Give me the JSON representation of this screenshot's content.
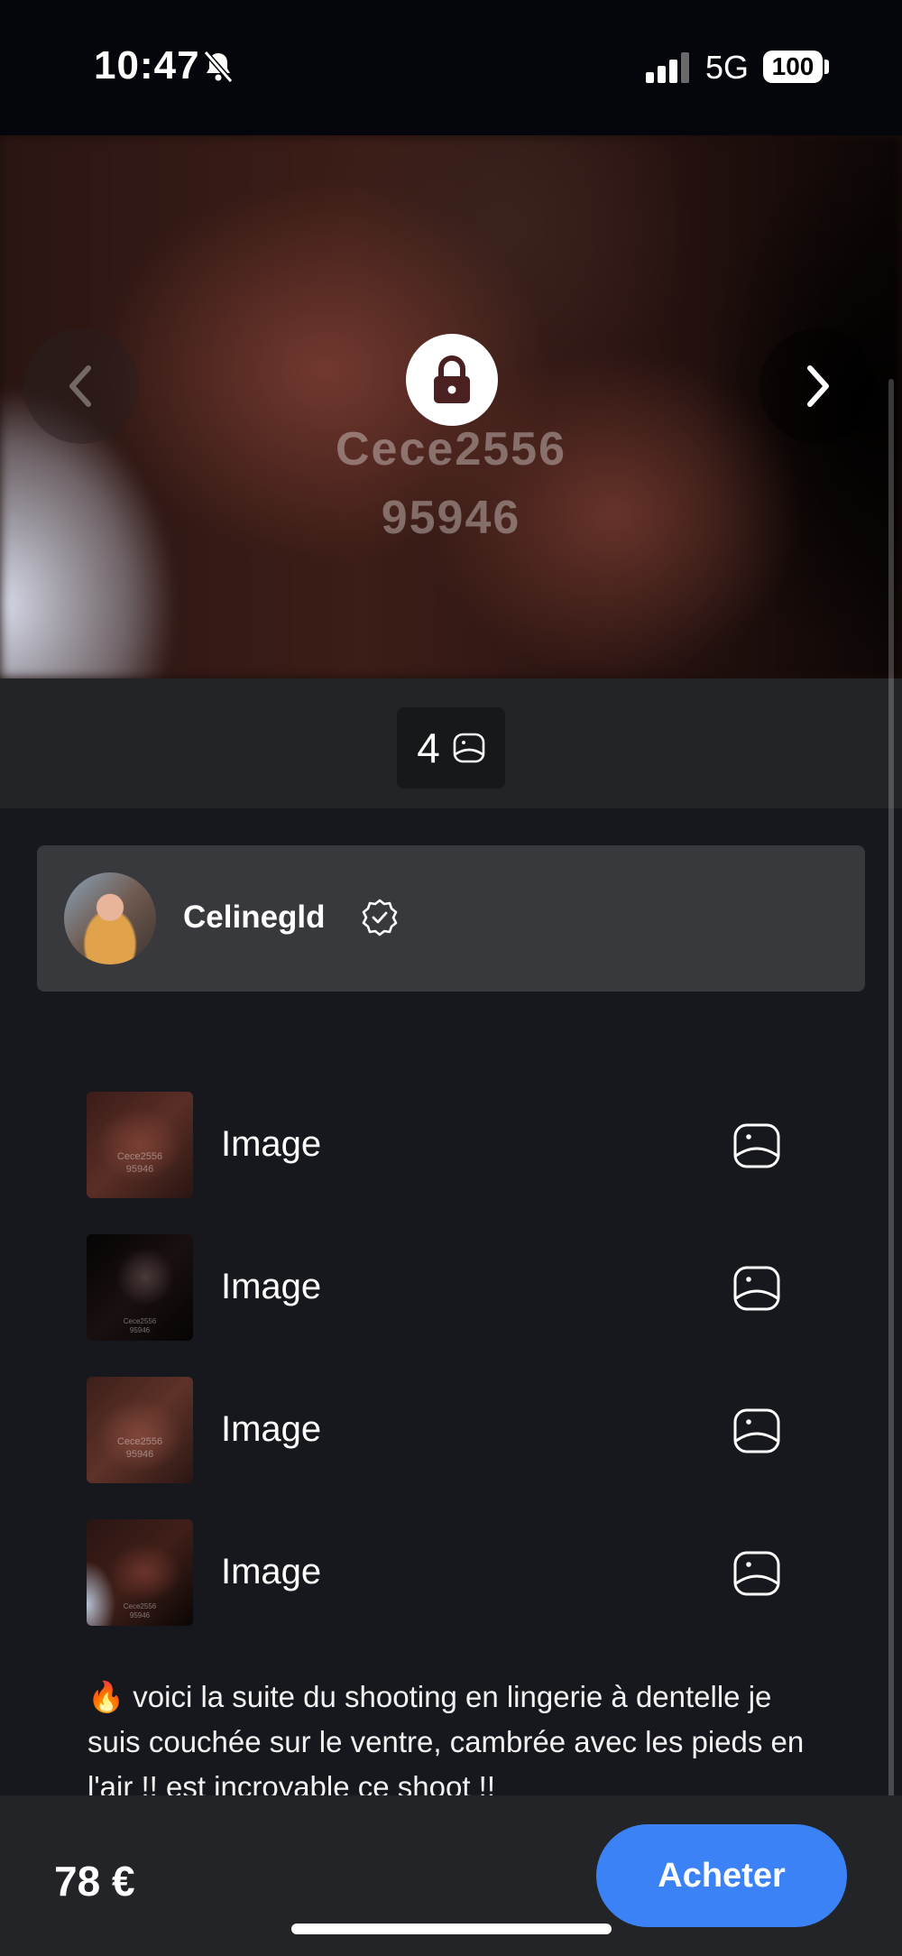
{
  "status_bar": {
    "time": "10:47",
    "network": "5G",
    "battery": "100",
    "icons": [
      "bell-muted-icon",
      "signal-icon",
      "battery-icon"
    ]
  },
  "hero": {
    "watermark_line1": "Cece2556",
    "watermark_line2": "95946",
    "icons": [
      "chevron-left-icon",
      "lock-icon",
      "chevron-right-icon"
    ]
  },
  "media_count": {
    "count": "4",
    "icon": "image-icon"
  },
  "creator": {
    "name": "Celinegld",
    "verified_icon": "verified-badge-icon"
  },
  "media_items": [
    {
      "label": "Image",
      "thumb_wm1": "Cece2556",
      "thumb_wm2": "95946"
    },
    {
      "label": "Image",
      "thumb_wm1": "Cece2556",
      "thumb_wm2": "95946"
    },
    {
      "label": "Image",
      "thumb_wm1": "Cece2556",
      "thumb_wm2": "95946"
    },
    {
      "label": "Image",
      "thumb_wm1": "Cece2556",
      "thumb_wm2": "95946"
    }
  ],
  "caption": "🔥 voici la suite du shooting en lingerie à dentelle je suis couchée sur le ventre, cambrée avec les pieds en l'air !! est incroyable ce shoot !!",
  "purchase": {
    "price": "78 €",
    "button_label": "Acheter"
  },
  "colors": {
    "accent": "#3b82f6",
    "background": "#17181d",
    "card": "#38393d"
  }
}
